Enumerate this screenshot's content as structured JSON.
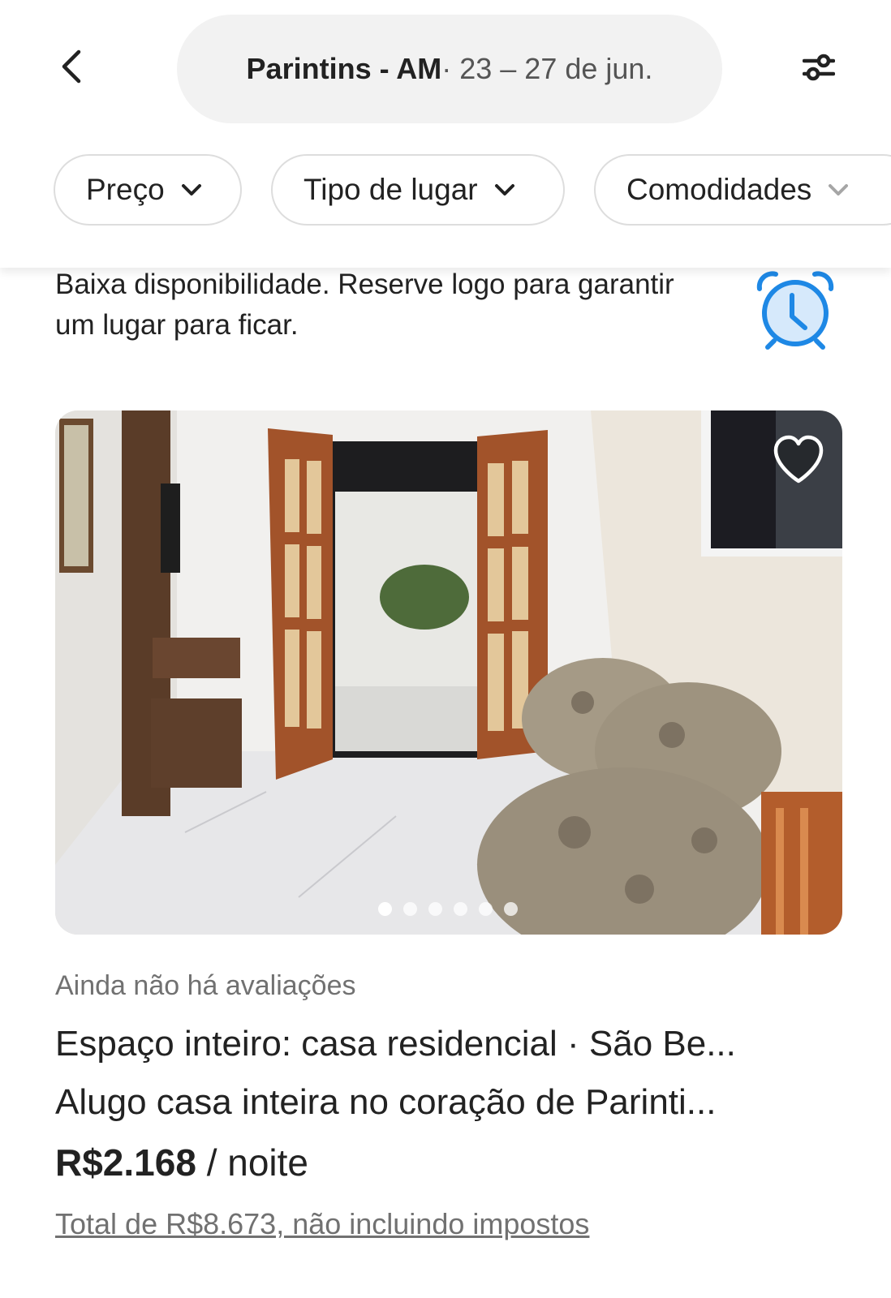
{
  "header": {
    "location": "Parintins - AM",
    "dates": " · 23 – 27 de jun.",
    "back_icon": "chevron-left-icon",
    "filter_icon": "sliders-icon"
  },
  "filters": [
    {
      "label": "Preço"
    },
    {
      "label": "Tipo de lugar"
    },
    {
      "label": "Comodidades"
    }
  ],
  "notice": {
    "text": "Baixa disponibilidade. Reserve logo para garantir um lugar para ficar.",
    "icon": "alarm-clock-icon",
    "icon_color": "#1e88e5"
  },
  "listing": {
    "favorite_icon": "heart-icon",
    "photo_count": 6,
    "active_photo": 0,
    "reviews": "Ainda não há avaliações",
    "title": "Espaço inteiro: casa residencial · São Be...",
    "description": "Alugo casa inteira no coração de Parinti...",
    "price": "R$2.168",
    "price_unit": " / noite",
    "total": "Total de R$8.673, não incluindo impostos"
  }
}
